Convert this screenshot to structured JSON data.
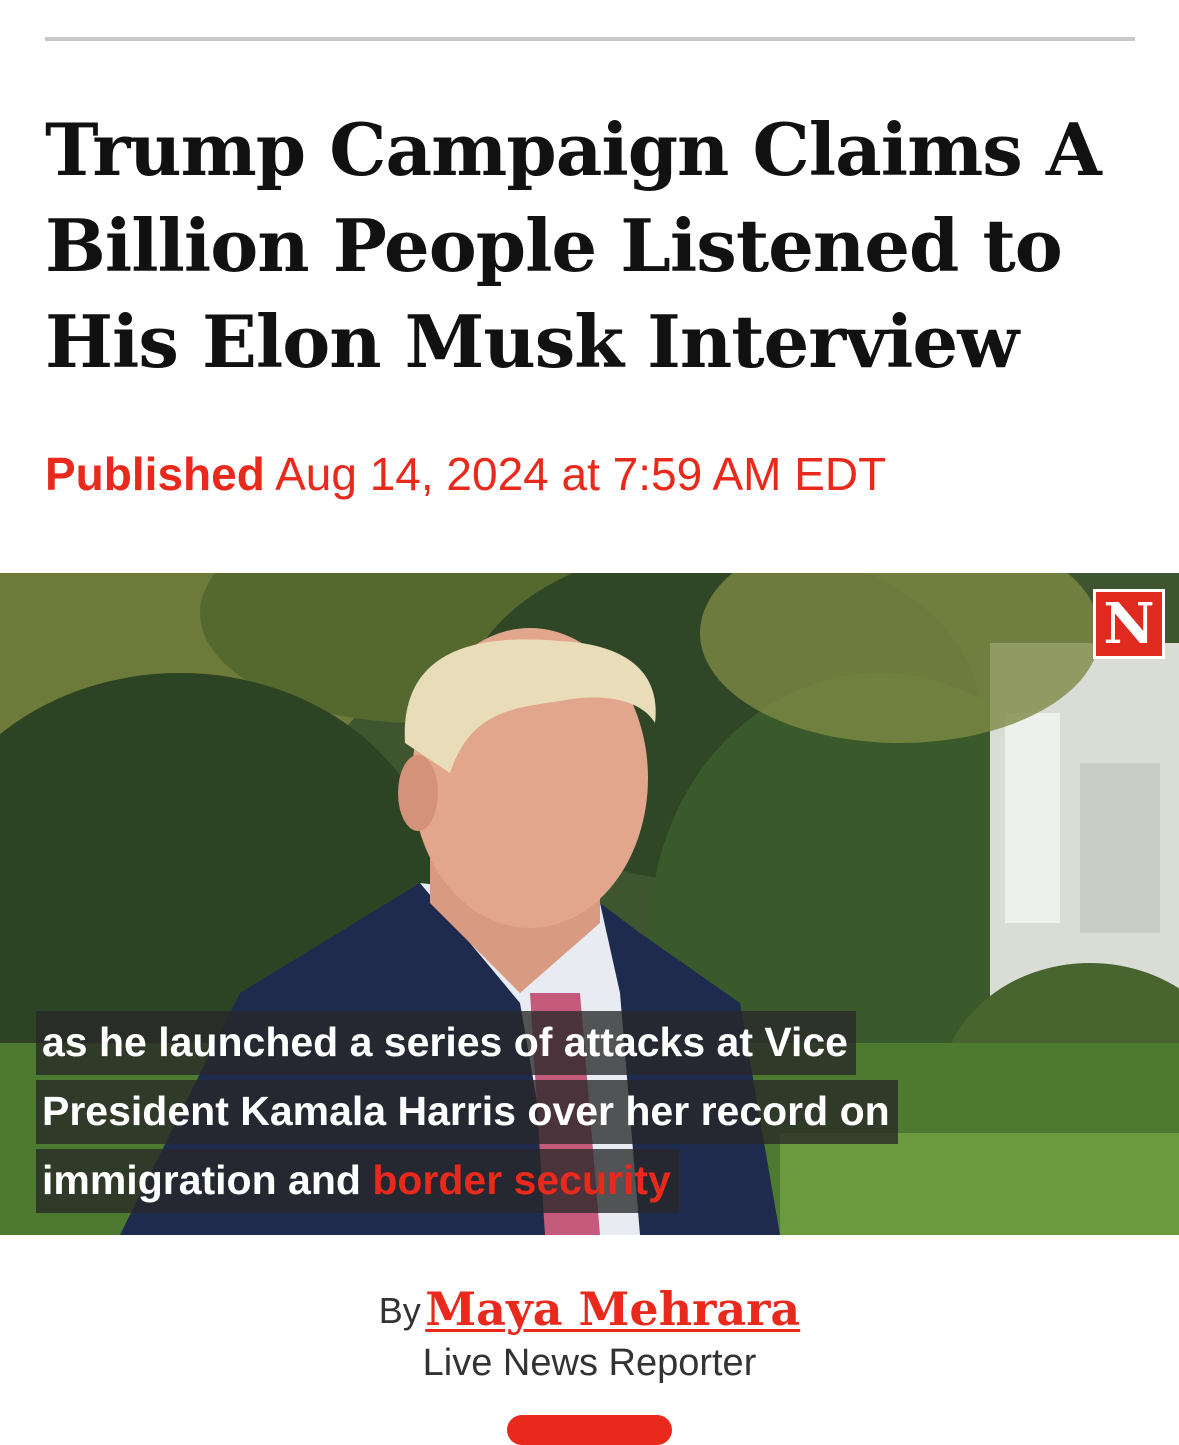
{
  "article": {
    "headline": "Trump Campaign Claims A Billion People Listened to His Elon Musk Interview",
    "published_label": "Published",
    "published_date": "Aug 14, 2024 at 7:59 AM EDT"
  },
  "hero": {
    "logo_letter": "N",
    "captions": {
      "line1": "as he launched a series of attacks at Vice",
      "line2": "President Kamala Harris over her record on",
      "line3_plain": "immigration and",
      "line3_highlight": "border security"
    },
    "colors": {
      "logo_bg": "#e02a20",
      "caption_highlight": "#e8291c"
    }
  },
  "byline": {
    "prefix": "By",
    "author": "Maya Mehrara",
    "role": "Live News Reporter"
  },
  "theme": {
    "accent": "#e8291c",
    "text": "#111111"
  }
}
